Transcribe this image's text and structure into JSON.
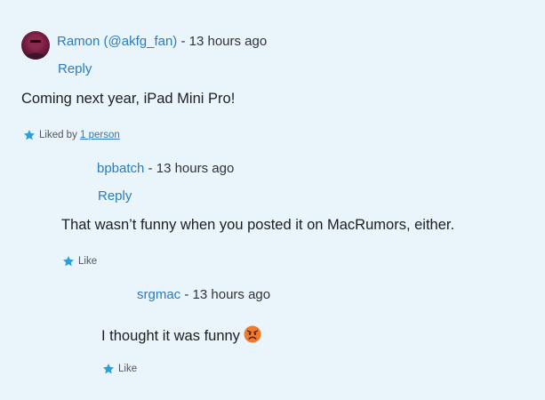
{
  "comments": [
    {
      "author": "Ramon (@akfg_fan)",
      "separator": " - ",
      "time": "13 hours ago",
      "reply_label": "Reply",
      "body": "Coming next year, iPad Mini Pro!",
      "liked_by_prefix": "Liked by ",
      "liked_by_link": "1 person"
    },
    {
      "author": "bpbatch",
      "separator": " - ",
      "time": "13 hours ago",
      "reply_label": "Reply",
      "body": "That wasn’t funny when you posted it on MacRumors, either.",
      "like_label": "Like"
    },
    {
      "author": "srgmac",
      "separator": " - ",
      "time": "13 hours ago",
      "body": "I thought it was funny",
      "like_label": "Like"
    }
  ],
  "colors": {
    "background": "#e9f4fb",
    "link": "#2b7bbf",
    "star": "#2ba0d8",
    "emoji": "#f07a2a"
  },
  "icons": {
    "star": "star-icon",
    "emoji": "angry-face-emoji"
  }
}
